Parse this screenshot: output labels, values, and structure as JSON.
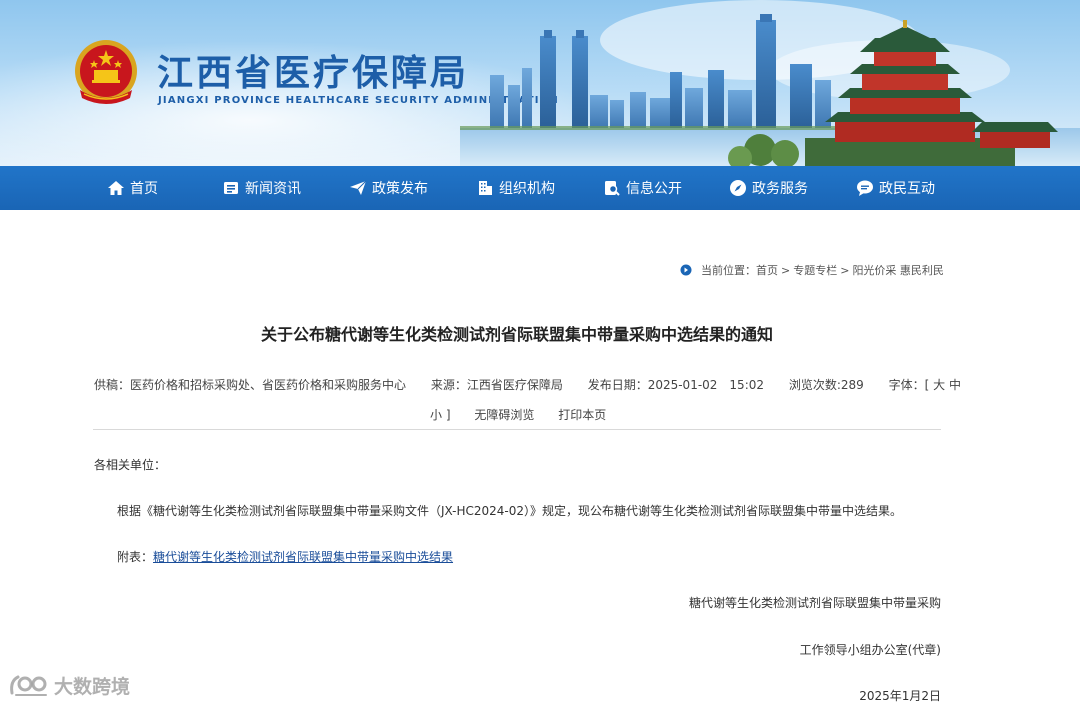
{
  "header": {
    "site_title": "江西省医疗保障局",
    "site_subtitle": "JIANGXI PROVINCE HEALTHCARE SECURITY ADMINISTRATION"
  },
  "nav": {
    "items": [
      {
        "label": "首页",
        "icon": "home-icon"
      },
      {
        "label": "新闻资讯",
        "icon": "news-icon"
      },
      {
        "label": "政策发布",
        "icon": "paper-plane-icon"
      },
      {
        "label": "组织机构",
        "icon": "building-icon"
      },
      {
        "label": "信息公开",
        "icon": "document-search-icon"
      },
      {
        "label": "政务服务",
        "icon": "compass-icon"
      },
      {
        "label": "政民互动",
        "icon": "chat-icon"
      }
    ]
  },
  "breadcrumb": {
    "prefix": "当前位置：",
    "items": [
      "首页",
      "专题专栏",
      "阳光价采 惠民利民"
    ],
    "separator": ">"
  },
  "article": {
    "title": "关于公布糖代谢等生化类检测试剂省际联盟集中带量采购中选结果的通知",
    "meta": {
      "contributor": "供稿：医药价格和招标采购处、省医药价格和采购服务中心",
      "source": "来源：江西省医疗保障局",
      "publish_date": "发布日期：2025-01-02　15:02",
      "views": "浏览次数:289",
      "font_size_prefix": "字体：[",
      "font_large": "大",
      "font_medium": "中",
      "font_small": "小",
      "font_size_suffix": "]",
      "accessible": "无障碍浏览",
      "print": "打印本页"
    },
    "greeting": "各相关单位：",
    "paragraph": "根据《糖代谢等生化类检测试剂省际联盟集中带量采购文件（JX-HC2024-02）》规定，现公布糖代谢等生化类检测试剂省际联盟集中带量中选结果。",
    "attachment_prefix": "附表：",
    "attachment_link": "糖代谢等生化类检测试剂省际联盟集中带量采购中选结果",
    "signature_line1": "糖代谢等生化类检测试剂省际联盟集中带量采购",
    "signature_line2": "工作领导小组办公室(代章)",
    "signature_date": "2025年1月2日"
  },
  "watermark": {
    "text": "大数跨境"
  },
  "colors": {
    "brand_blue": "#1d5ea8",
    "nav_blue": "#1a65b5",
    "link_blue": "#1a4d99"
  }
}
